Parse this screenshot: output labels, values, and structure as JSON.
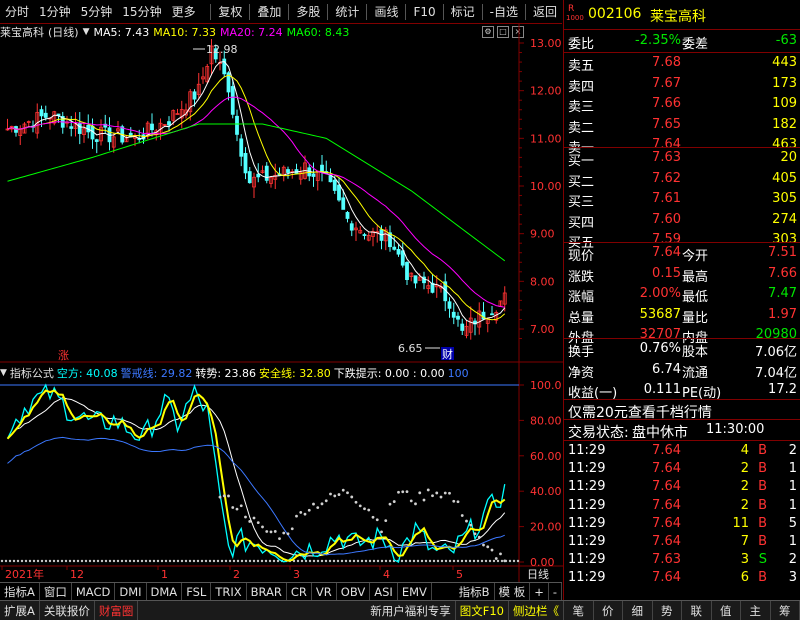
{
  "toolbar": {
    "left_items": [
      "分时",
      "1分钟",
      "5分钟",
      "15分钟",
      "更多"
    ],
    "right_items": [
      "复权",
      "叠加",
      "多股",
      "统计",
      "画线",
      "F10",
      "标记",
      "-自选",
      "返回"
    ]
  },
  "chart": {
    "stock_name": "莱宝高科",
    "period": "(日线)",
    "ma5": "MA5: 7.43",
    "ma10": "MA10: 7.33",
    "ma20": "MA20: 7.24",
    "ma60": "MA60: 8.43",
    "high_label": "12.98",
    "low_label": "6.65",
    "zhang_marker": "涨",
    "cai_marker": "财",
    "y_ticks": [
      "13.00",
      "12.00",
      "11.00",
      "10.00",
      "9.00",
      "8.00",
      "7.00"
    ],
    "colors": {
      "ma5": "#ffffff",
      "ma10": "#ffff00",
      "ma20": "#ff00ff",
      "ma60": "#00ff00",
      "up": "#ff3232",
      "down": "#54ffff"
    }
  },
  "indicator": {
    "title": "指标公式",
    "kongfang": "空方: 40.08",
    "jingjie": "警戒线: 29.82",
    "zhuanshi": "转势: 23.86",
    "anquan": "安全线: 32.80",
    "xiadie": "下跌提示: 0.00 : 0.00",
    "value_100": "100",
    "y_ticks": [
      "100.0",
      "80.00",
      "60.00",
      "40.00",
      "20.00",
      "0.00"
    ]
  },
  "x_axis": {
    "labels": [
      "2021年",
      "12",
      "1",
      "2",
      "3",
      "4",
      "5"
    ],
    "period_label": "日线"
  },
  "bottom_tabs": [
    "指标A",
    "窗口",
    "MACD",
    "DMI",
    "DMA",
    "FSL",
    "TRIX",
    "BRAR",
    "CR",
    "VR",
    "OBV",
    "ASI",
    "EMV",
    "指标B",
    "模 板",
    "+",
    "-"
  ],
  "status_bar": {
    "left": [
      "扩展A",
      "关联报价",
      "财富圈"
    ],
    "news": "新用户福利专享",
    "right_items": [
      "图文F10",
      "侧边栏《"
    ],
    "side_tabs": [
      "笔",
      "价",
      "细",
      "势",
      "联",
      "值",
      "主",
      "筹"
    ]
  },
  "quote": {
    "r_label": "R",
    "code_small": "1000",
    "code": "002106",
    "name": "莱宝高科",
    "weibi_label": "委比",
    "weibi": "-2.35%",
    "weicha_label": "委差",
    "weicha": "-63",
    "sell": [
      {
        "label": "卖五",
        "price": "7.68",
        "vol": "443"
      },
      {
        "label": "卖四",
        "price": "7.67",
        "vol": "173"
      },
      {
        "label": "卖三",
        "price": "7.66",
        "vol": "109"
      },
      {
        "label": "卖二",
        "price": "7.65",
        "vol": "182"
      },
      {
        "label": "卖一",
        "price": "7.64",
        "vol": "463"
      }
    ],
    "buy": [
      {
        "label": "买一",
        "price": "7.63",
        "vol": "20"
      },
      {
        "label": "买二",
        "price": "7.62",
        "vol": "405"
      },
      {
        "label": "买三",
        "price": "7.61",
        "vol": "305"
      },
      {
        "label": "买四",
        "price": "7.60",
        "vol": "274"
      },
      {
        "label": "买五",
        "price": "7.59",
        "vol": "303"
      }
    ],
    "stats": [
      {
        "l1": "现价",
        "v1": "7.64",
        "l2": "今开",
        "v2": "7.51"
      },
      {
        "l1": "涨跌",
        "v1": "0.15",
        "l2": "最高",
        "v2": "7.66"
      },
      {
        "l1": "涨幅",
        "v1": "2.00%",
        "l2": "最低",
        "v2": "7.47"
      },
      {
        "l1": "总量",
        "v1": "53687",
        "l2": "量比",
        "v2": "1.97"
      },
      {
        "l1": "外盘",
        "v1": "32707",
        "l2": "内盘",
        "v2": "20980"
      }
    ],
    "stats2": [
      {
        "l1": "换手",
        "v1": "0.76%",
        "l2": "股本",
        "v2": "7.06亿"
      },
      {
        "l1": "净资",
        "v1": "6.74",
        "l2": "流通",
        "v2": "7.04亿"
      },
      {
        "l1": "收益(一)",
        "v1": "0.111",
        "l2": "PE(动)",
        "v2": "17.2"
      }
    ],
    "promo": "仅需20元查看千档行情",
    "trade_status_label": "交易状态:",
    "trade_status": "盘中休市",
    "trade_time": "11:30:00",
    "ticks": [
      {
        "t": "11:29",
        "p": "7.64",
        "v": "4",
        "bs": "B",
        "n": "2"
      },
      {
        "t": "11:29",
        "p": "7.64",
        "v": "2",
        "bs": "B",
        "n": "1"
      },
      {
        "t": "11:29",
        "p": "7.64",
        "v": "2",
        "bs": "B",
        "n": "1"
      },
      {
        "t": "11:29",
        "p": "7.64",
        "v": "2",
        "bs": "B",
        "n": "1"
      },
      {
        "t": "11:29",
        "p": "7.64",
        "v": "11",
        "bs": "B",
        "n": "5"
      },
      {
        "t": "11:29",
        "p": "7.64",
        "v": "7",
        "bs": "B",
        "n": "1"
      },
      {
        "t": "11:29",
        "p": "7.63",
        "v": "3",
        "bs": "S",
        "n": "2"
      },
      {
        "t": "11:29",
        "p": "7.64",
        "v": "6",
        "bs": "B",
        "n": "3"
      }
    ]
  }
}
